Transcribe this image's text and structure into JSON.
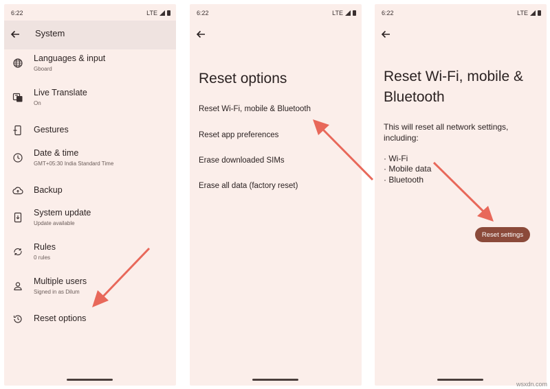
{
  "status": {
    "time": "6:22",
    "network": "LTE"
  },
  "screen1": {
    "title": "System",
    "items": [
      {
        "label": "Languages & input",
        "sub": "Gboard",
        "icon": "globe-icon"
      },
      {
        "label": "Live Translate",
        "sub": "On",
        "icon": "translate-icon"
      },
      {
        "label": "Gestures",
        "sub": "",
        "icon": "gestures-icon"
      },
      {
        "label": "Date & time",
        "sub": "GMT+05:30 India Standard Time",
        "icon": "clock-icon"
      },
      {
        "label": "Backup",
        "sub": "",
        "icon": "cloud-upload-icon"
      },
      {
        "label": "System update",
        "sub": "Update available",
        "icon": "system-update-icon"
      },
      {
        "label": "Rules",
        "sub": "0 rules",
        "icon": "rules-icon"
      },
      {
        "label": "Multiple users",
        "sub": "Signed in as Dilum",
        "icon": "person-icon"
      },
      {
        "label": "Reset options",
        "sub": "",
        "icon": "history-icon"
      }
    ]
  },
  "screen2": {
    "title": "Reset options",
    "options": [
      "Reset Wi-Fi, mobile & Bluetooth",
      "Reset app preferences",
      "Erase downloaded SIMs",
      "Erase all data (factory reset)"
    ]
  },
  "screen3": {
    "title_line1": "Reset Wi-Fi, mobile &",
    "title_line2": "Bluetooth",
    "desc_line1": "This will reset all network settings,",
    "desc_line2": "including:",
    "bullets": [
      "· Wi-Fi",
      "· Mobile data",
      "· Bluetooth"
    ],
    "button": "Reset settings"
  },
  "watermark": "wsxdn.com",
  "colors": {
    "background": "#fbeeea",
    "arrow": "#e8685a",
    "button": "#8b4a3a"
  }
}
